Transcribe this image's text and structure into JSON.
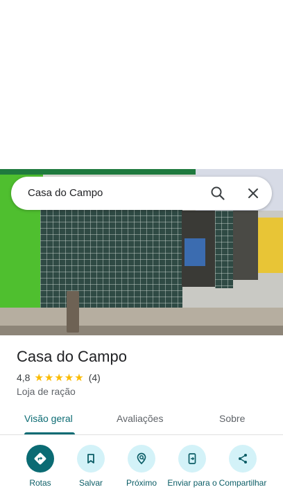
{
  "search": {
    "query": "Casa do Campo"
  },
  "place": {
    "name": "Casa do Campo",
    "rating": "4,8",
    "stars": "★★★★★",
    "review_count": "(4)",
    "category": "Loja de ração"
  },
  "tabs": [
    {
      "label": "Visão geral",
      "active": true
    },
    {
      "label": "Avaliações",
      "active": false
    },
    {
      "label": "Sobre",
      "active": false
    }
  ],
  "actions": [
    {
      "label": "Rotas",
      "icon": "directions-icon"
    },
    {
      "label": "Salvar",
      "icon": "bookmark-icon"
    },
    {
      "label": "Próximo",
      "icon": "nearby-icon"
    },
    {
      "label": "Enviar para o",
      "icon": "send-to-phone-icon"
    },
    {
      "label": "Compartilhar",
      "icon": "share-icon"
    }
  ],
  "colors": {
    "accent": "#0b6b73",
    "action_bg": "#d3f2f8",
    "star": "#fbbc04"
  }
}
